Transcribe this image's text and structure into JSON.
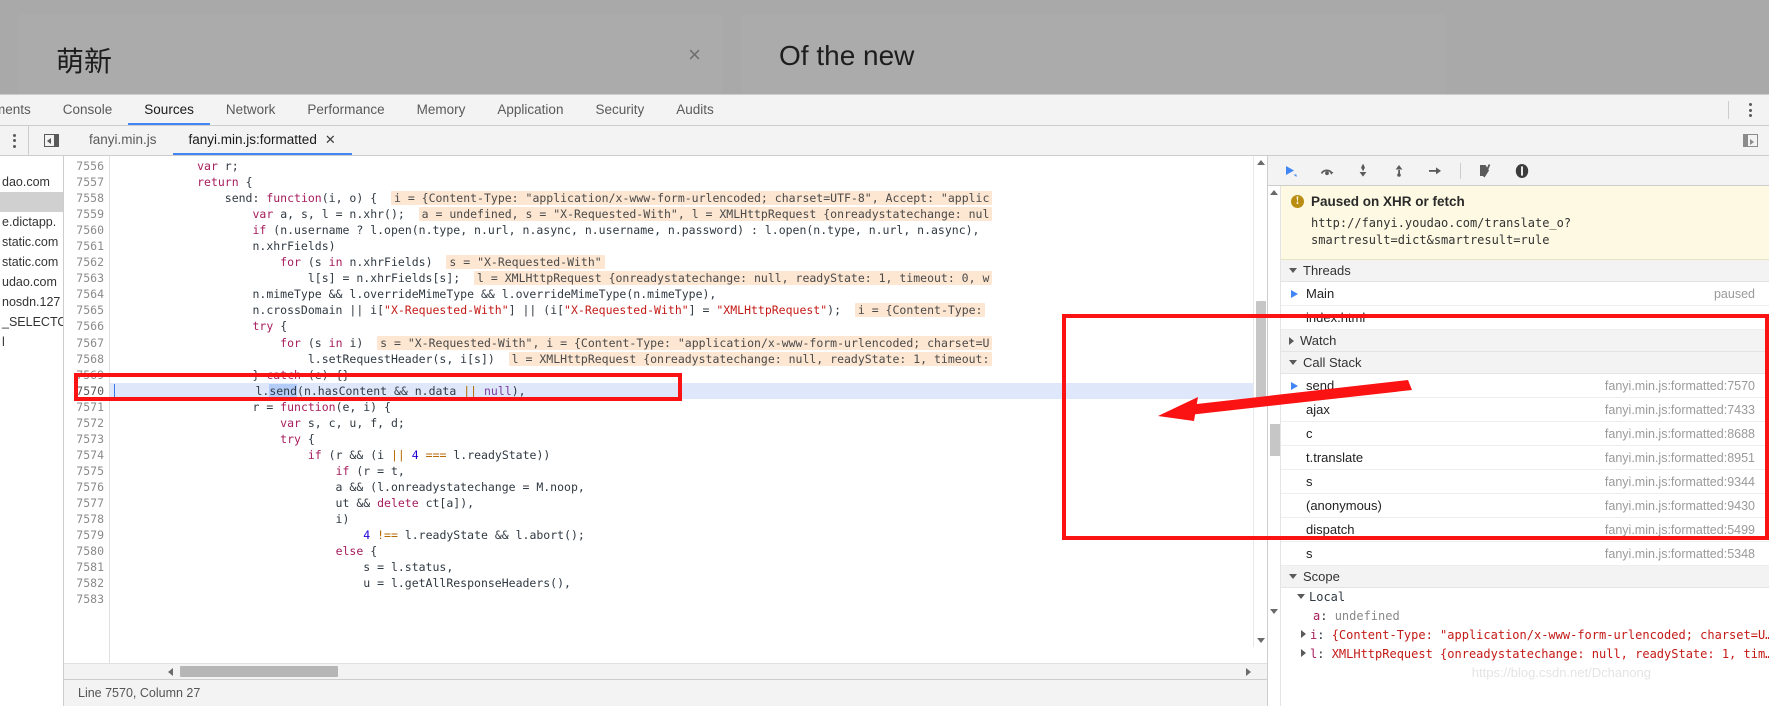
{
  "page": {
    "source_popup": {
      "text": "萌新",
      "close_label": "×"
    },
    "target_popup": {
      "text": "Of the new"
    }
  },
  "devtools": {
    "main_tabs": [
      {
        "label": "ments",
        "active": false,
        "clipped": true
      },
      {
        "label": "Console",
        "active": false
      },
      {
        "label": "Sources",
        "active": true
      },
      {
        "label": "Network",
        "active": false
      },
      {
        "label": "Performance",
        "active": false
      },
      {
        "label": "Memory",
        "active": false
      },
      {
        "label": "Application",
        "active": false
      },
      {
        "label": "Security",
        "active": false
      },
      {
        "label": "Audits",
        "active": false
      }
    ],
    "file_tabs": [
      {
        "label": "fanyi.min.js",
        "active": false,
        "closable": false
      },
      {
        "label": "fanyi.min.js:formatted",
        "active": true,
        "closable": true,
        "close_label": "✕"
      }
    ],
    "navigator_items": [
      {
        "label": "dao.com",
        "selected": false
      },
      {
        "label": "",
        "selected": true
      },
      {
        "label": "e.dictapp.",
        "selected": false
      },
      {
        "label": "static.com",
        "selected": false
      },
      {
        "label": "static.com",
        "selected": false
      },
      {
        "label": "udao.com",
        "selected": false
      },
      {
        "label": "nosdn.127",
        "selected": false
      },
      {
        "label": "_SELECTOR",
        "selected": false
      },
      {
        "label": "l",
        "selected": false
      }
    ],
    "status_bar": {
      "text": "Line 7570, Column 27"
    }
  },
  "editor": {
    "first_line_number": 7556,
    "executing_line": 7570,
    "lines": [
      {
        "n": 7556,
        "html": "            <span class='tok-kw'>var</span> r;"
      },
      {
        "n": 7557,
        "html": "            <span class='tok-kw'>return</span> {"
      },
      {
        "n": 7558,
        "html": "                send: <span class='tok-kw'>function</span>(i, o) {  <span class='inlay'>i = {Content-Type: \"application/x-www-form-urlencoded; charset=UTF-8\", Accept: \"applic</span>"
      },
      {
        "n": 7559,
        "html": "                    <span class='tok-kw'>var</span> a, s, l = n.xhr();  <span class='inlay'>a = undefined, s = \"X-Requested-With\", l = XMLHttpRequest {onreadystatechange: nul</span>"
      },
      {
        "n": 7560,
        "html": "                    <span class='tok-kw'>if</span> (n.username ? l.open(n.type, n.url, n.async, n.username, n.password) : l.open(n.type, n.url, n.async),</span>"
      },
      {
        "n": 7561,
        "html": "                    n.xhrFields)"
      },
      {
        "n": 7562,
        "html": "                        <span class='tok-kw'>for</span> (s <span class='tok-kw'>in</span> n.xhrFields)  <span class='inlay'>s = \"X-Requested-With\"</span>"
      },
      {
        "n": 7563,
        "html": "                            l[s] = n.xhrFields[s];  <span class='inlay'>l = XMLHttpRequest {onreadystatechange: null, readyState: 1, timeout: 0, w</span>"
      },
      {
        "n": 7564,
        "html": "                    n.mimeType &amp;&amp; l.overrideMimeType &amp;&amp; l.overrideMimeType(n.mimeType),"
      },
      {
        "n": 7565,
        "html": "                    n.crossDomain || i[<span class='tok-str'>\"X-Requested-With\"</span>] || (i[<span class='tok-str'>\"X-Requested-With\"</span>] = <span class='tok-str'>\"XMLHttpRequest\"</span>);  <span class='inlay'>i = {Content-Type:</span>"
      },
      {
        "n": 7566,
        "html": "                    <span class='tok-kw'>try</span> {"
      },
      {
        "n": 7567,
        "html": "                        <span class='tok-kw'>for</span> (s <span class='tok-kw'>in</span> i)  <span class='inlay'>s = \"X-Requested-With\", i = {Content-Type: \"application/x-www-form-urlencoded; charset=U</span>"
      },
      {
        "n": 7568,
        "html": "                            l.setRequestHeader(s, i[s])  <span class='inlay'>l = XMLHttpRequest {onreadystatechange: null, readyState: 1, timeout:</span>"
      },
      {
        "n": 7569,
        "html": "                    } <span class='tok-kw'>catch</span> (e) {}"
      },
      {
        "n": 7570,
        "html": "                    l.<span class='sel-send'>send</span>(n.hasContent &amp;&amp; n.data <span class='tok-op'>||</span> <span class='tok-kw2'>null</span>),"
      },
      {
        "n": 7571,
        "html": "                    r = <span class='tok-kw'>function</span>(e, i) {"
      },
      {
        "n": 7572,
        "html": "                        <span class='tok-kw'>var</span> s, c, u, f, d;"
      },
      {
        "n": 7573,
        "html": "                        <span class='tok-kw'>try</span> {"
      },
      {
        "n": 7574,
        "html": "                            <span class='tok-kw'>if</span> (r &amp;&amp; (i <span class='tok-op'>||</span> <span class='tok-num'>4</span> <span class='tok-op'>===</span> l.readyState))"
      },
      {
        "n": 7575,
        "html": "                                <span class='tok-kw'>if</span> (r = t,"
      },
      {
        "n": 7576,
        "html": "                                a &amp;&amp; (l.onreadystatechange = M.noop,"
      },
      {
        "n": 7577,
        "html": "                                ut &amp;&amp; <span class='tok-kw'>delete</span> ct[a]),"
      },
      {
        "n": 7578,
        "html": "                                i)"
      },
      {
        "n": 7579,
        "html": "                                    <span class='tok-num'>4</span> <span class='tok-op'>!==</span> l.readyState &amp;&amp; l.abort();"
      },
      {
        "n": 7580,
        "html": "                                <span class='tok-kw'>else</span> {"
      },
      {
        "n": 7581,
        "html": "                                    s = l.status,"
      },
      {
        "n": 7582,
        "html": "                                    u = l.getAllResponseHeaders(),"
      },
      {
        "n": 7583,
        "html": ""
      }
    ]
  },
  "debugger_pane": {
    "toolbar_buttons": [
      "resume-script-execution",
      "step-over-next-function-call",
      "step-into-next-function-call",
      "step-out-of-current-function",
      "step",
      "deactivate-breakpoints",
      "pause-on-exceptions"
    ],
    "paused_banner": {
      "title": "Paused on XHR or fetch",
      "url_line1": "http://fanyi.youdao.com/translate_o?",
      "url_line2": "smartresult=dict&smartresult=rule"
    },
    "threads": {
      "header": "Threads",
      "expanded": true,
      "items": [
        {
          "name": "Main",
          "status": "paused",
          "current": true
        },
        {
          "name": "index.html",
          "status": "",
          "current": false
        }
      ]
    },
    "watch": {
      "header": "Watch",
      "expanded": false
    },
    "call_stack": {
      "header": "Call Stack",
      "expanded": true,
      "frames": [
        {
          "name": "send",
          "location": "fanyi.min.js:formatted:7570",
          "current": true
        },
        {
          "name": "ajax",
          "location": "fanyi.min.js:formatted:7433",
          "current": false
        },
        {
          "name": "c",
          "location": "fanyi.min.js:formatted:8688",
          "current": false
        },
        {
          "name": "t.translate",
          "location": "fanyi.min.js:formatted:8951",
          "current": false
        },
        {
          "name": "s",
          "location": "fanyi.min.js:formatted:9344",
          "current": false
        },
        {
          "name": "(anonymous)",
          "location": "fanyi.min.js:formatted:9430",
          "current": false
        },
        {
          "name": "dispatch",
          "location": "fanyi.min.js:formatted:5499",
          "current": false
        },
        {
          "name": "s",
          "location": "fanyi.min.js:formatted:5348",
          "current": false
        }
      ]
    },
    "scope": {
      "header": "Scope",
      "expanded": true,
      "local_label": "Local",
      "entries": [
        {
          "expandable": false,
          "name": "a",
          "value": "undefined",
          "value_kind": "undefined"
        },
        {
          "expandable": true,
          "name": "i",
          "value": "{Content-Type: \"application/x-www-form-urlencoded; charset=U…",
          "value_kind": "object"
        },
        {
          "expandable": true,
          "name": "l",
          "value": "XMLHttpRequest {onreadystatechange: null, readyState: 1, tim…",
          "value_kind": "object"
        }
      ]
    }
  },
  "annotations": {
    "highlight_color": "#fb1212",
    "boxes": [
      {
        "name": "executing-line-highlight-box"
      },
      {
        "name": "call-stack-highlight-box"
      }
    ],
    "arrow": {
      "name": "call-stack-pointer-arrow"
    }
  },
  "watermark": {
    "text": "https://blog.csdn.net/Dchanong"
  }
}
